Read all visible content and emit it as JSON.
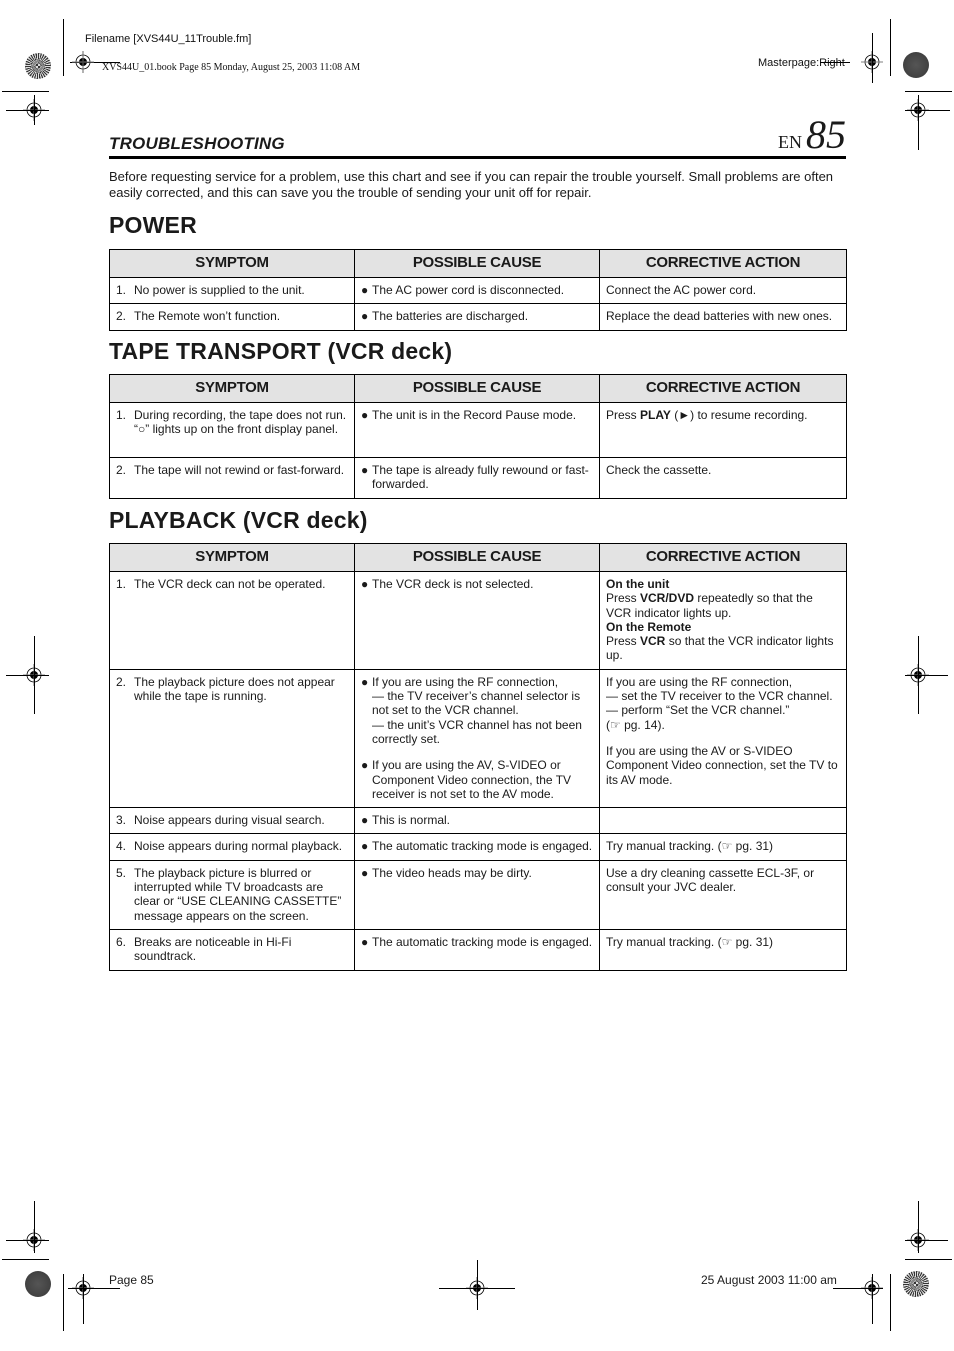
{
  "slug": {
    "filename": "Filename [XVS44U_11Trouble.fm]",
    "book_info": "XVS44U_01.book  Page 85  Monday, August 25, 2003  11:08 AM",
    "masterpage": "Masterpage:Right"
  },
  "header": {
    "section": "TROUBLESHOOTING",
    "lang": "EN",
    "page_number": "85"
  },
  "intro": "Before requesting service for a problem, use this chart and see if you can repair the trouble yourself. Small problems are often easily corrected, and this can save you the trouble of sending your unit off for repair.",
  "columns": {
    "symptom": "SYMPTOM",
    "cause": "POSSIBLE CAUSE",
    "action": "CORRECTIVE ACTION"
  },
  "sections": {
    "power": {
      "title": "POWER",
      "rows": [
        {
          "num": "1.",
          "symptom": "No power is supplied to the unit.",
          "cause": "The AC power cord is disconnected.",
          "action": "Connect the AC power cord."
        },
        {
          "num": "2.",
          "symptom": "The Remote won’t function.",
          "cause": "The batteries are discharged.",
          "action": "Replace the dead batteries with new ones."
        }
      ]
    },
    "tape": {
      "title": "TAPE TRANSPORT (VCR deck)",
      "rows": [
        {
          "num": "1.",
          "symptom_a": "During recording, the tape does not run. “",
          "symptom_icon": "○",
          "symptom_b": "” lights up on the front display panel.",
          "cause": "The unit is in the Record Pause mode.",
          "action_a": "Press ",
          "action_bold": "PLAY",
          "action_b": " (►) to resume recording."
        },
        {
          "num": "2.",
          "symptom": "The tape will not rewind or fast-forward.",
          "cause": "The tape is already fully rewound or fast-forwarded.",
          "action": "Check the cassette."
        }
      ]
    },
    "playback": {
      "title": "PLAYBACK (VCR deck)",
      "rows": [
        {
          "num": "1.",
          "symptom": "The VCR deck can not be operated.",
          "cause": "The VCR deck is not selected.",
          "action": {
            "unit_heading": "On the unit",
            "unit_pre": "Press ",
            "unit_bold": "VCR/DVD",
            "unit_post": " repeatedly so that the VCR indicator lights up.",
            "remote_heading": "On the Remote",
            "remote_pre": "Press ",
            "remote_bold": "VCR",
            "remote_post": " so that the VCR indicator lights up."
          }
        },
        {
          "num": "2.",
          "symptom": "The playback picture does not appear while the tape is running.",
          "cause_rf": "If you are using the RF connection,",
          "cause_rf_1": "— the TV receiver’s channel selector is not set to the VCR channel.",
          "cause_rf_2": "— the unit’s VCR channel has not been correctly set.",
          "cause_av": "If you are using the AV, S-VIDEO or Component Video connection, the TV receiver is not set to the AV mode.",
          "action_rf": "If you are using the RF connection,",
          "action_rf_1": "— set the TV receiver to the VCR channel.",
          "action_rf_2": "— perform “Set the VCR channel.”",
          "action_rf_ref": "(☞ pg. 14).",
          "action_av": "If you are using the AV or S-VIDEO Component Video connection, set the TV to its AV mode."
        },
        {
          "num": "3.",
          "symptom": "Noise appears during visual search.",
          "cause": "This is normal.",
          "action": ""
        },
        {
          "num": "4.",
          "symptom": "Noise appears during normal playback.",
          "cause": "The automatic tracking mode is engaged.",
          "action": "Try manual tracking. (☞ pg. 31)"
        },
        {
          "num": "5.",
          "symptom": "The playback picture is blurred or interrupted while TV broadcasts are clear or “USE CLEANING CASSETTE” message appears on the screen.",
          "cause": "The video heads may be dirty.",
          "action": "Use a dry cleaning cassette ECL-3F, or consult your JVC dealer."
        },
        {
          "num": "6.",
          "symptom": "Breaks are noticeable in Hi-Fi soundtrack.",
          "cause": "The automatic tracking mode is engaged.",
          "action": "Try manual tracking. (☞ pg. 31)"
        }
      ]
    }
  },
  "bullet": "●",
  "footer": {
    "page": "Page 85",
    "date": "25 August 2003 11:00 am"
  }
}
